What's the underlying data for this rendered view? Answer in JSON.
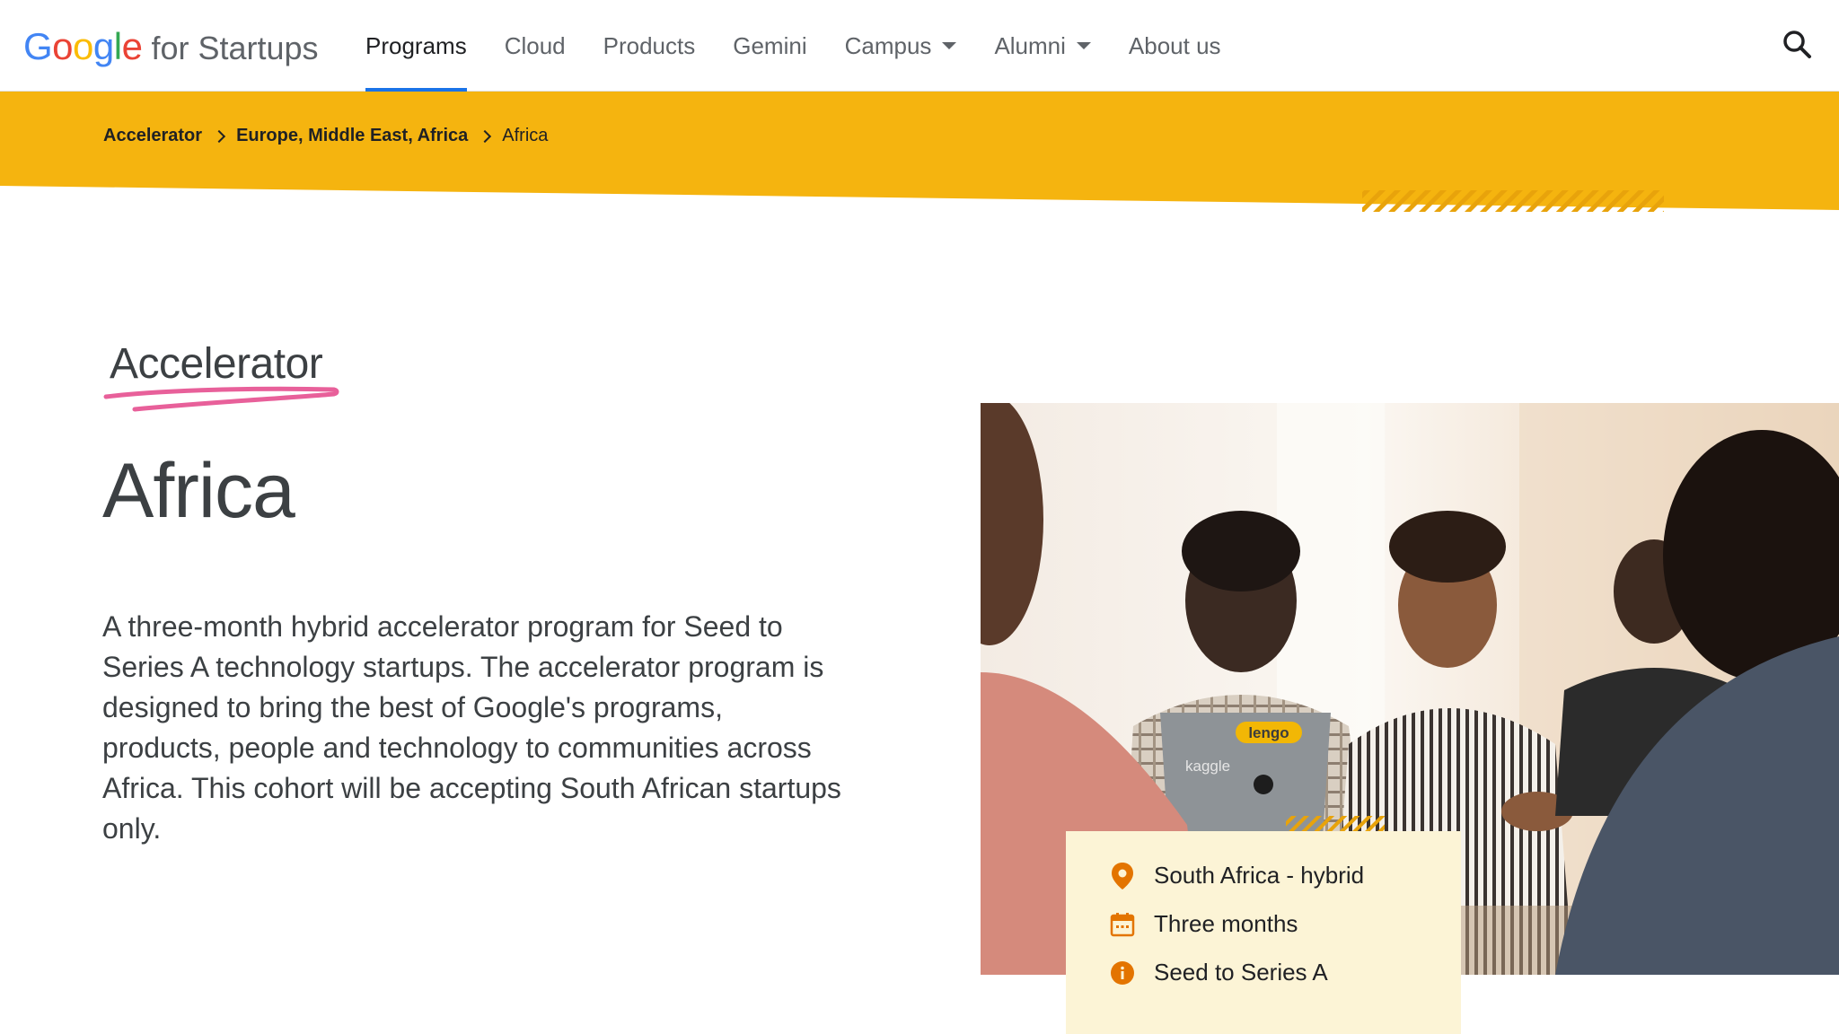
{
  "header": {
    "logo_google": "Google",
    "logo_suffix": "for Startups",
    "nav": [
      {
        "label": "Programs"
      },
      {
        "label": "Cloud"
      },
      {
        "label": "Products"
      },
      {
        "label": "Gemini"
      },
      {
        "label": "Campus"
      },
      {
        "label": "Alumni"
      },
      {
        "label": "About us"
      }
    ]
  },
  "breadcrumb": {
    "items": [
      "Accelerator",
      "Europe, Middle East, Africa"
    ],
    "current": "Africa"
  },
  "main": {
    "eyebrow": "Accelerator",
    "title": "Africa",
    "description": "A three-month hybrid accelerator program for Seed to Series A technology startups. The accelerator program is designed to bring the best of Google's programs, products, people and technology to communities across Africa. This cohort will be accepting South African startups only."
  },
  "photo": {
    "laptop_sticker": "lengo",
    "laptop_brand": "kaggle"
  },
  "info_card": {
    "location": "South Africa - hybrid",
    "duration": "Three months",
    "stage": "Seed to Series A"
  },
  "colors": {
    "banner": "#f5b40f",
    "accent": "#1a73e8",
    "icon_orange": "#e37400",
    "underline_pink": "#e8609a",
    "card_bg": "#fcf4d6"
  }
}
